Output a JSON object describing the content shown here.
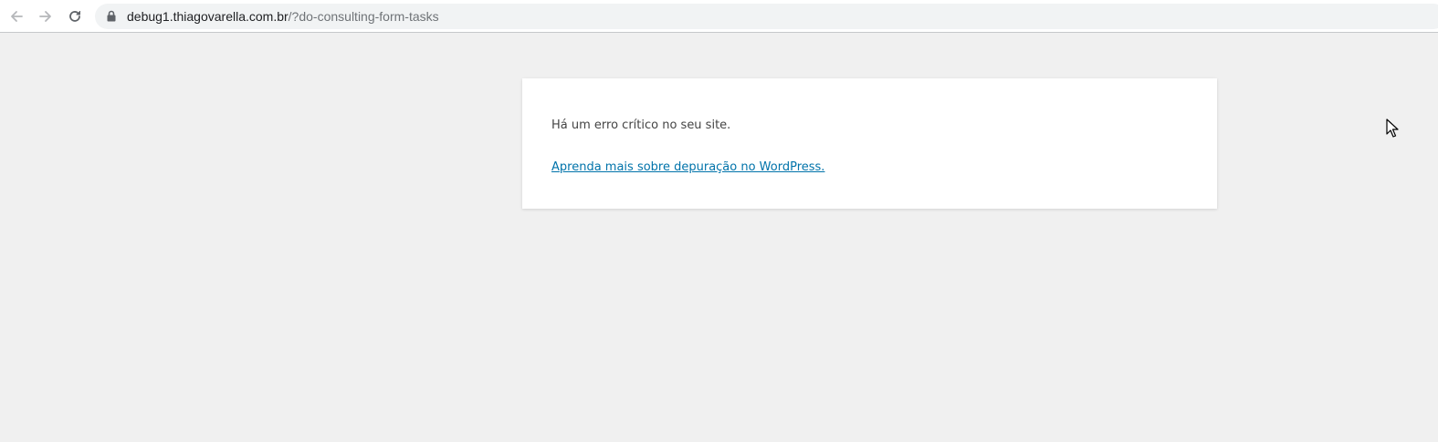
{
  "browser": {
    "url_host": "debug1.thiagovarella.com.br",
    "url_path": "/?do-consulting-form-tasks",
    "icons": {
      "back": "arrow-left-icon",
      "forward": "arrow-right-icon",
      "reload": "reload-icon",
      "secure": "lock-icon"
    }
  },
  "page": {
    "error_message": "Há um erro crítico no seu site.",
    "help_link": "Aprenda mais sobre depuração no WordPress.",
    "colors": {
      "background": "#f0f0f0",
      "box": "#ffffff",
      "text": "#444444",
      "link": "#0073aa"
    }
  }
}
